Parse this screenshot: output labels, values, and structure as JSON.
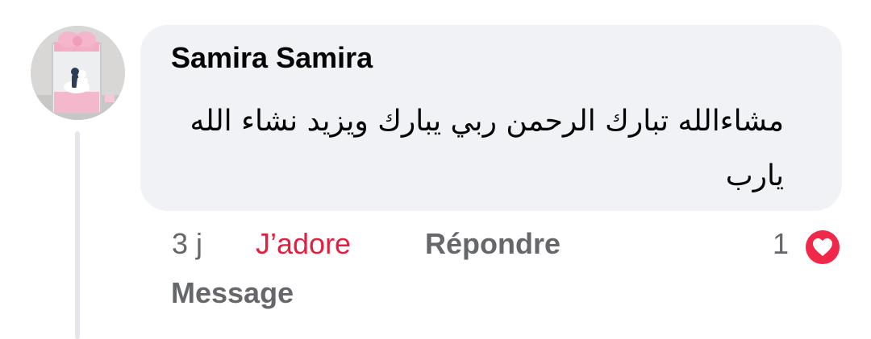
{
  "comment": {
    "author": "Samira Samira",
    "text": "مشاءالله تبارك الرحمن ربي يبارك ويزيد نشاء الله يارب",
    "time": "3 j",
    "like_label": "J’adore",
    "reply_label": "Répondre",
    "message_label": "Message",
    "reaction_count": "1"
  },
  "icons": {
    "reaction": "heart-icon",
    "avatar": "profile-photo"
  },
  "colors": {
    "bubble": "#f0f2f5",
    "like_active": "#e41e3f",
    "secondary_text": "#65676b",
    "heart_badge": "#f0284a"
  }
}
